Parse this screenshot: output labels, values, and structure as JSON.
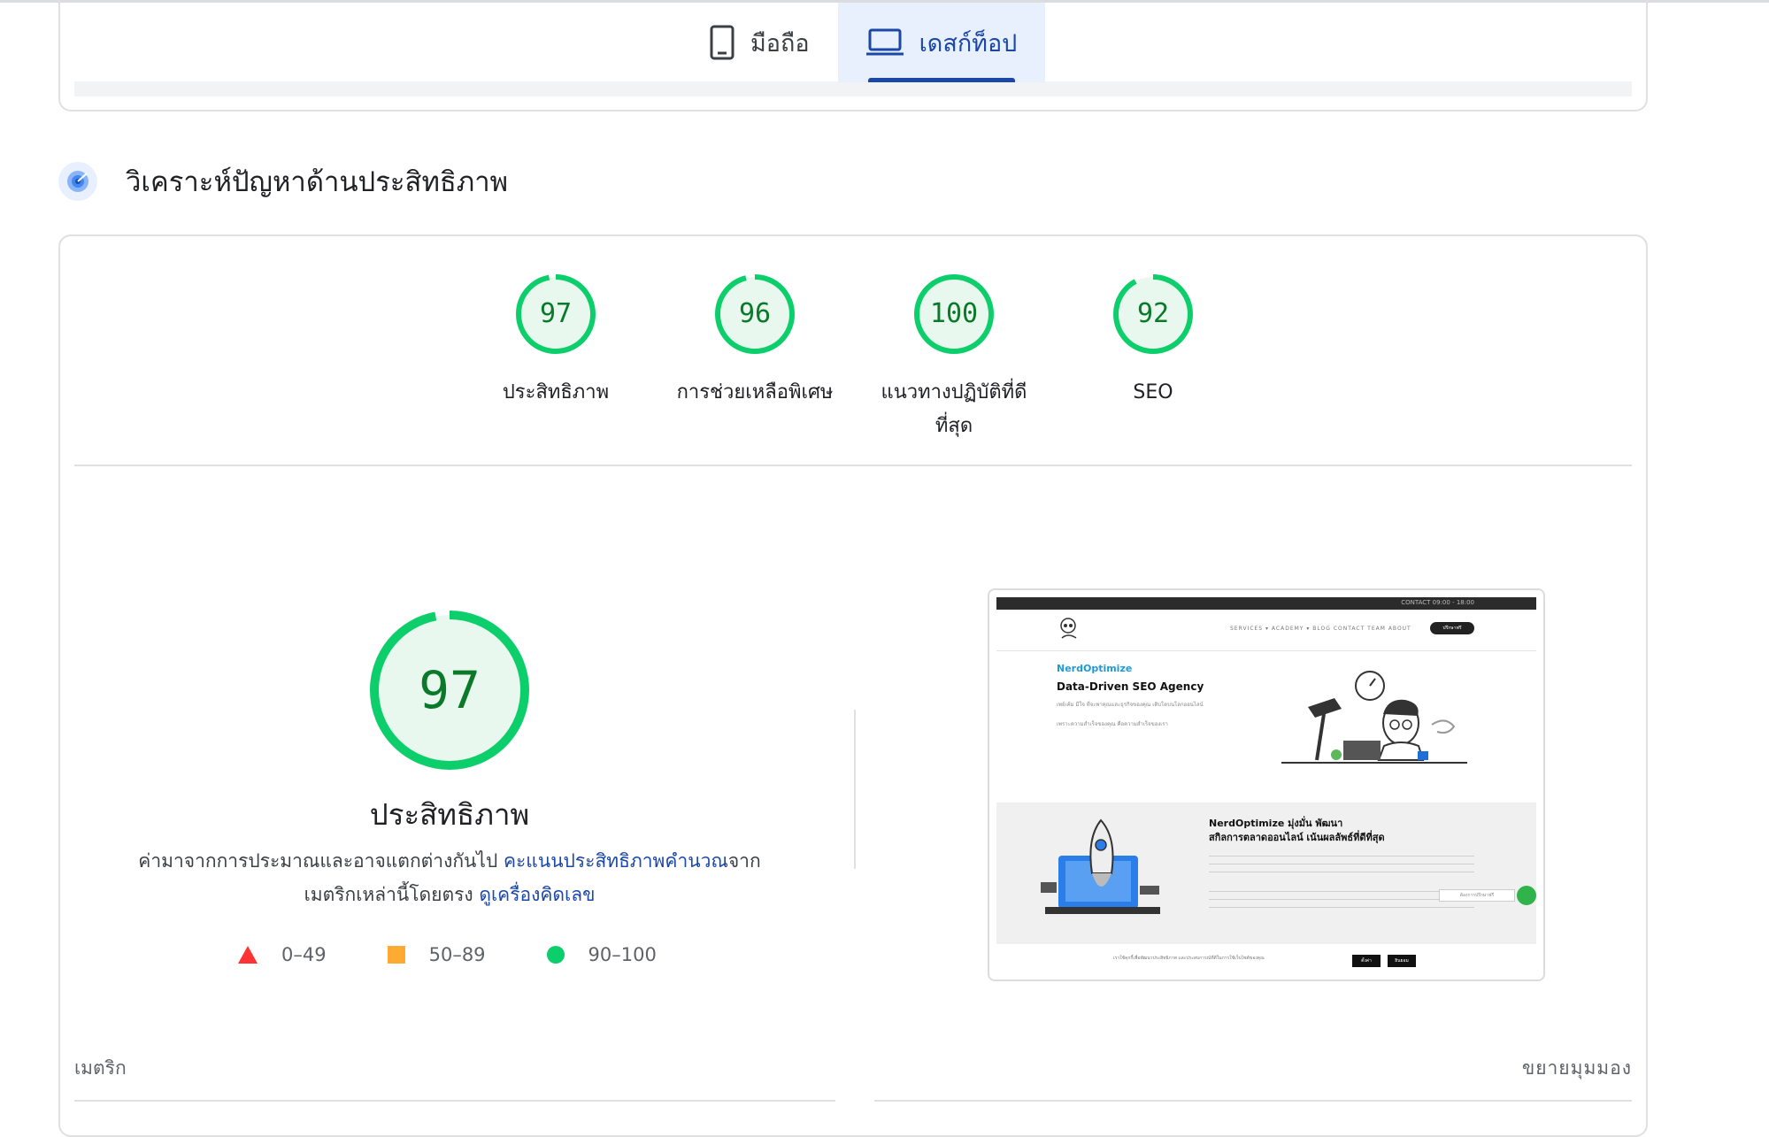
{
  "tabs": [
    {
      "label": "มือถือ",
      "icon": "phone-icon",
      "active": false
    },
    {
      "label": "เดสก์ท็อป",
      "icon": "laptop-icon",
      "active": true
    }
  ],
  "section": {
    "title": "วิเคราะห์ปัญหาด้านประสิทธิภาพ",
    "icon": "radar-icon"
  },
  "scores": [
    {
      "value": "97",
      "label": "ประสิทธิภาพ",
      "fraction": 0.97
    },
    {
      "value": "96",
      "label": "การช่วยเหลือพิเศษ",
      "fraction": 0.96
    },
    {
      "value": "100",
      "label_line1": "แนวทางปฏิบัติที่ดี",
      "label_line2": "ที่สุด",
      "fraction": 1.0
    },
    {
      "value": "92",
      "label": "SEO",
      "fraction": 0.92
    }
  ],
  "performance": {
    "score": "97",
    "fraction": 0.97,
    "title": "ประสิทธิภาพ",
    "desc_part1": "ค่ามาจากการประมาณและอาจแตกต่างกันไป ",
    "desc_link1": "คะแนนประสิทธิภาพคำนวณ",
    "desc_part2": "จาก",
    "desc_part3": "เมตริกเหล่านี้โดยตรง ",
    "desc_link2": "ดูเครื่องคิดเลข"
  },
  "legend": [
    {
      "range": "0–49",
      "shape": "triangle",
      "color": "#ff3333"
    },
    {
      "range": "50–89",
      "shape": "square",
      "color": "#ffaa33"
    },
    {
      "range": "90–100",
      "shape": "circle",
      "color": "#0cce6b"
    }
  ],
  "screenshot": {
    "topbar_text": "CONTACT   09:00 - 18:00",
    "nav": "SERVICES ▾   ACADEMY ▾   BLOG   CONTACT   TEAM   ABOUT",
    "nav_button": "ปรึกษาฟรี",
    "brand": "NerdOptimize",
    "headline": "Data-Driven SEO Agency",
    "line1": "เพย์เค้ม มีใจ ที่จะพาคุณและธุรกิจของคุณ เติบโตบนโลกออนไลน์",
    "line2": "เพราะความสำเร็จของคุณ คือความสำเร็จของเรา",
    "headline2_line1": "NerdOptimize มุ่งมั่น พัฒนา",
    "headline2_line2": "สกิลการตลาดออนไลน์ เน้นผลลัพธ์ที่ดีที่สุด",
    "chat_placeholder": "ต้องการปรึกษาฟรี",
    "cookie_text": "เราใช้คุกกี้เพื่อพัฒนาประสิทธิภาพ และประสบการณ์ที่ดีในการใช้เว็บไซต์ของคุณ",
    "accept": "ยินยอม",
    "settings": "ตั้งค่า"
  },
  "metrics": {
    "label": "เมตริก",
    "expand": "ขยายมุมมอง"
  },
  "colors": {
    "pass": "#0cce6b",
    "pass_text": "#0a7a2a",
    "pass_bg": "#e8f8ee",
    "accent": "#1a47a8"
  }
}
